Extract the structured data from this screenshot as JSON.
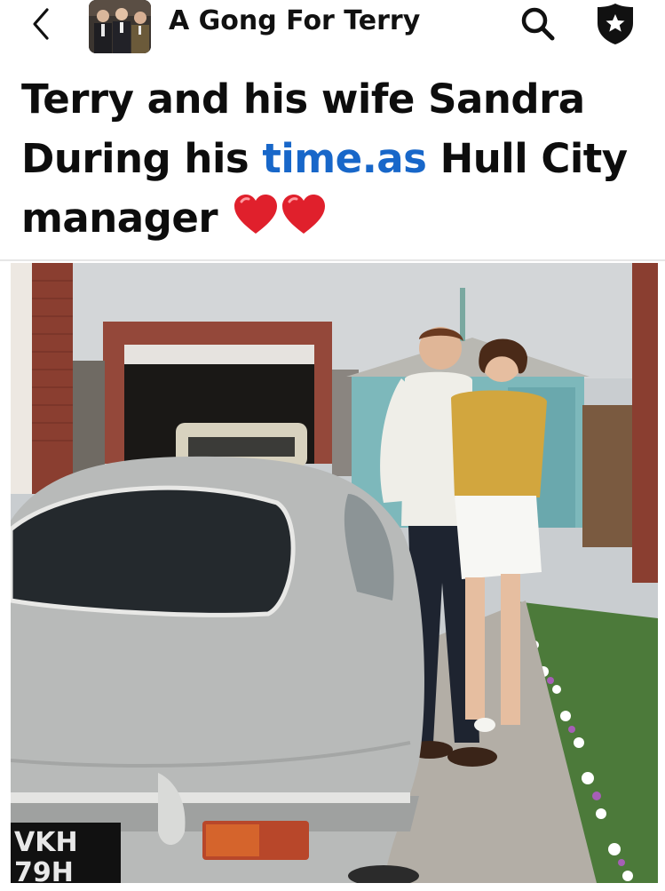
{
  "header": {
    "back_icon": "chevron-left-icon",
    "group_name": "A Gong For Terry",
    "search_icon": "search-icon",
    "badge_icon": "shield-star-icon"
  },
  "post": {
    "line1": "Terry and his wife Sandra",
    "line2_before": "During his ",
    "line2_link": "time.as",
    "line2_after": " Hull City",
    "line3": "manager",
    "emoji": "❤️❤️",
    "link_color": "#1867c9"
  },
  "photo": {
    "plate_text_1": "VKH",
    "plate_text_2": "79H"
  }
}
